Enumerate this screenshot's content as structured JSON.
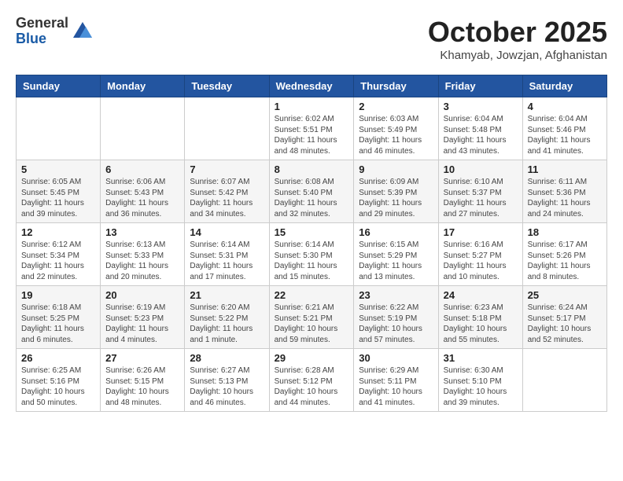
{
  "header": {
    "logo": {
      "general": "General",
      "blue": "Blue"
    },
    "title": "October 2025",
    "location": "Khamyab, Jowzjan, Afghanistan"
  },
  "calendar": {
    "days_of_week": [
      "Sunday",
      "Monday",
      "Tuesday",
      "Wednesday",
      "Thursday",
      "Friday",
      "Saturday"
    ],
    "weeks": [
      [
        {
          "day": "",
          "info": ""
        },
        {
          "day": "",
          "info": ""
        },
        {
          "day": "",
          "info": ""
        },
        {
          "day": "1",
          "info": "Sunrise: 6:02 AM\nSunset: 5:51 PM\nDaylight: 11 hours and 48 minutes."
        },
        {
          "day": "2",
          "info": "Sunrise: 6:03 AM\nSunset: 5:49 PM\nDaylight: 11 hours and 46 minutes."
        },
        {
          "day": "3",
          "info": "Sunrise: 6:04 AM\nSunset: 5:48 PM\nDaylight: 11 hours and 43 minutes."
        },
        {
          "day": "4",
          "info": "Sunrise: 6:04 AM\nSunset: 5:46 PM\nDaylight: 11 hours and 41 minutes."
        }
      ],
      [
        {
          "day": "5",
          "info": "Sunrise: 6:05 AM\nSunset: 5:45 PM\nDaylight: 11 hours and 39 minutes."
        },
        {
          "day": "6",
          "info": "Sunrise: 6:06 AM\nSunset: 5:43 PM\nDaylight: 11 hours and 36 minutes."
        },
        {
          "day": "7",
          "info": "Sunrise: 6:07 AM\nSunset: 5:42 PM\nDaylight: 11 hours and 34 minutes."
        },
        {
          "day": "8",
          "info": "Sunrise: 6:08 AM\nSunset: 5:40 PM\nDaylight: 11 hours and 32 minutes."
        },
        {
          "day": "9",
          "info": "Sunrise: 6:09 AM\nSunset: 5:39 PM\nDaylight: 11 hours and 29 minutes."
        },
        {
          "day": "10",
          "info": "Sunrise: 6:10 AM\nSunset: 5:37 PM\nDaylight: 11 hours and 27 minutes."
        },
        {
          "day": "11",
          "info": "Sunrise: 6:11 AM\nSunset: 5:36 PM\nDaylight: 11 hours and 24 minutes."
        }
      ],
      [
        {
          "day": "12",
          "info": "Sunrise: 6:12 AM\nSunset: 5:34 PM\nDaylight: 11 hours and 22 minutes."
        },
        {
          "day": "13",
          "info": "Sunrise: 6:13 AM\nSunset: 5:33 PM\nDaylight: 11 hours and 20 minutes."
        },
        {
          "day": "14",
          "info": "Sunrise: 6:14 AM\nSunset: 5:31 PM\nDaylight: 11 hours and 17 minutes."
        },
        {
          "day": "15",
          "info": "Sunrise: 6:14 AM\nSunset: 5:30 PM\nDaylight: 11 hours and 15 minutes."
        },
        {
          "day": "16",
          "info": "Sunrise: 6:15 AM\nSunset: 5:29 PM\nDaylight: 11 hours and 13 minutes."
        },
        {
          "day": "17",
          "info": "Sunrise: 6:16 AM\nSunset: 5:27 PM\nDaylight: 11 hours and 10 minutes."
        },
        {
          "day": "18",
          "info": "Sunrise: 6:17 AM\nSunset: 5:26 PM\nDaylight: 11 hours and 8 minutes."
        }
      ],
      [
        {
          "day": "19",
          "info": "Sunrise: 6:18 AM\nSunset: 5:25 PM\nDaylight: 11 hours and 6 minutes."
        },
        {
          "day": "20",
          "info": "Sunrise: 6:19 AM\nSunset: 5:23 PM\nDaylight: 11 hours and 4 minutes."
        },
        {
          "day": "21",
          "info": "Sunrise: 6:20 AM\nSunset: 5:22 PM\nDaylight: 11 hours and 1 minute."
        },
        {
          "day": "22",
          "info": "Sunrise: 6:21 AM\nSunset: 5:21 PM\nDaylight: 10 hours and 59 minutes."
        },
        {
          "day": "23",
          "info": "Sunrise: 6:22 AM\nSunset: 5:19 PM\nDaylight: 10 hours and 57 minutes."
        },
        {
          "day": "24",
          "info": "Sunrise: 6:23 AM\nSunset: 5:18 PM\nDaylight: 10 hours and 55 minutes."
        },
        {
          "day": "25",
          "info": "Sunrise: 6:24 AM\nSunset: 5:17 PM\nDaylight: 10 hours and 52 minutes."
        }
      ],
      [
        {
          "day": "26",
          "info": "Sunrise: 6:25 AM\nSunset: 5:16 PM\nDaylight: 10 hours and 50 minutes."
        },
        {
          "day": "27",
          "info": "Sunrise: 6:26 AM\nSunset: 5:15 PM\nDaylight: 10 hours and 48 minutes."
        },
        {
          "day": "28",
          "info": "Sunrise: 6:27 AM\nSunset: 5:13 PM\nDaylight: 10 hours and 46 minutes."
        },
        {
          "day": "29",
          "info": "Sunrise: 6:28 AM\nSunset: 5:12 PM\nDaylight: 10 hours and 44 minutes."
        },
        {
          "day": "30",
          "info": "Sunrise: 6:29 AM\nSunset: 5:11 PM\nDaylight: 10 hours and 41 minutes."
        },
        {
          "day": "31",
          "info": "Sunrise: 6:30 AM\nSunset: 5:10 PM\nDaylight: 10 hours and 39 minutes."
        },
        {
          "day": "",
          "info": ""
        }
      ]
    ]
  }
}
